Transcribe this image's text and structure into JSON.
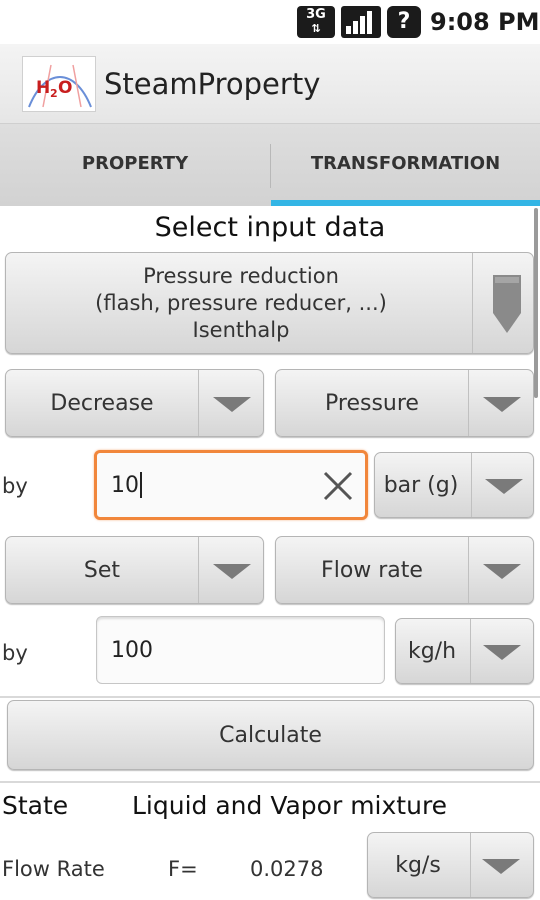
{
  "status_bar": {
    "network": "3G",
    "signal_icon": "signal-bars-icon",
    "help_icon": "help-icon",
    "time": "9:08 PM"
  },
  "app_bar": {
    "logo": "H2O",
    "title": "SteamProperty"
  },
  "tabs": [
    {
      "label": "PROPERTY",
      "selected": false
    },
    {
      "label": "TRANSFORMATION",
      "selected": true
    }
  ],
  "form": {
    "heading": "Select input data",
    "transformation_select": {
      "line1": "Pressure reduction",
      "line2": "(flash, pressure reducer, ...)",
      "line3": "Isenthalp"
    },
    "row1": {
      "action": "Decrease",
      "property": "Pressure",
      "by_label": "by",
      "value": "10",
      "unit": "bar (g)"
    },
    "row2": {
      "action": "Set",
      "property": "Flow rate",
      "by_label": "by",
      "value": "100",
      "unit": "kg/h"
    },
    "calculate_label": "Calculate"
  },
  "result": {
    "state_label": "State",
    "state_value": "Liquid and Vapor mixture",
    "flow_label": "Flow Rate",
    "flow_symbol": "F=",
    "flow_value": "0.0278",
    "flow_unit": "kg/s"
  },
  "colors": {
    "tab_indicator": "#33b5e5",
    "focus_border": "#f1863b"
  }
}
